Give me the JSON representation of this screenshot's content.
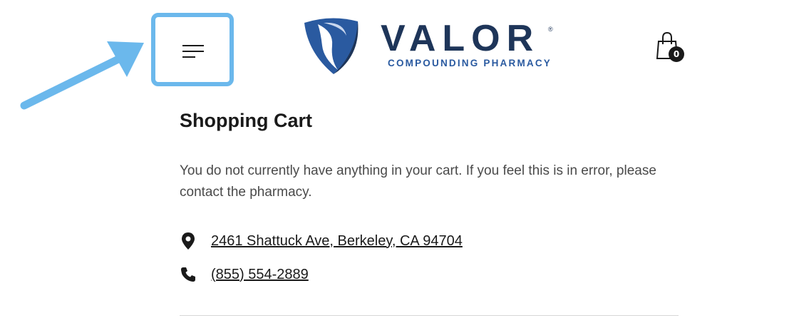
{
  "header": {
    "logo": {
      "wordmark": "VALOR",
      "registered_mark": "®",
      "tagline": "COMPOUNDING PHARMACY"
    },
    "cart_count": "0"
  },
  "main": {
    "title": "Shopping Cart",
    "empty_message": "You do not currently have anything in your cart. If you feel this is in error, please contact the pharmacy.",
    "address": "2461 Shattuck Ave, Berkeley, CA 94704",
    "phone": "(855) 554-2889"
  },
  "colors": {
    "highlight": "#6bb8ec",
    "brand_navy": "#1e3559",
    "brand_blue": "#2a5aa0"
  },
  "icons": [
    "menu-icon",
    "cart-icon",
    "location-pin-icon",
    "phone-icon"
  ]
}
